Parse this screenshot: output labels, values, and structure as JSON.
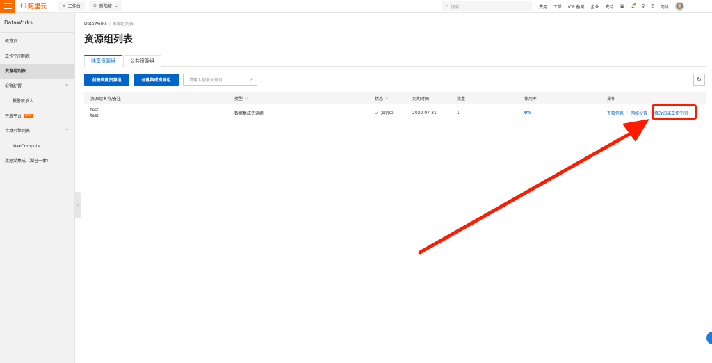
{
  "topbar": {
    "brand": "阿里云",
    "brand_mark": "(-)",
    "workbench": "工作台",
    "region": "新加坡",
    "search_placeholder": "搜索...",
    "links": [
      "费用",
      "工单",
      "ICP 备案",
      "企业",
      "支持"
    ],
    "language": "简体"
  },
  "sidebar": {
    "title": "DataWorks",
    "items": [
      {
        "label": "概览页"
      },
      {
        "label": "工作空间列表"
      },
      {
        "label": "资源组列表"
      },
      {
        "label": "报警配置"
      },
      {
        "label": "报警联系人"
      },
      {
        "label": "开放平台"
      },
      {
        "label": "计算引擎列表"
      },
      {
        "label": "MaxCompute"
      },
      {
        "label": "数据湖集成（湖仓一体）"
      }
    ],
    "new_badge": "New"
  },
  "breadcrumb": {
    "root": "DataWorks",
    "current": "资源组列表"
  },
  "page_title": "资源组列表",
  "tabs": [
    {
      "label": "独享资源组"
    },
    {
      "label": "公共资源组"
    }
  ],
  "toolbar": {
    "create_schedule": "创建调度资源组",
    "create_integration": "创建集成资源组",
    "search_placeholder": "请输入搜索关键词"
  },
  "table": {
    "headers": {
      "name": "资源组名称/备注",
      "type": "类型",
      "status": "状态",
      "expire": "到期时间",
      "quantity": "数量",
      "usage": "使用率",
      "actions": "操作"
    },
    "rows": [
      {
        "name": "test",
        "remark": "test",
        "type": "数据集成资源组",
        "status": "运行中",
        "expire": "2022-07-31",
        "quantity": "1",
        "usage": "0%",
        "action_view": "查看信息",
        "action_network": "网络设置",
        "action_modify": "修改归属工作空间"
      }
    ]
  },
  "colors": {
    "brand_orange": "#ff6a00",
    "primary_blue": "#0064c8",
    "annotation_red": "#ff1a00",
    "status_green": "#2da44e"
  }
}
